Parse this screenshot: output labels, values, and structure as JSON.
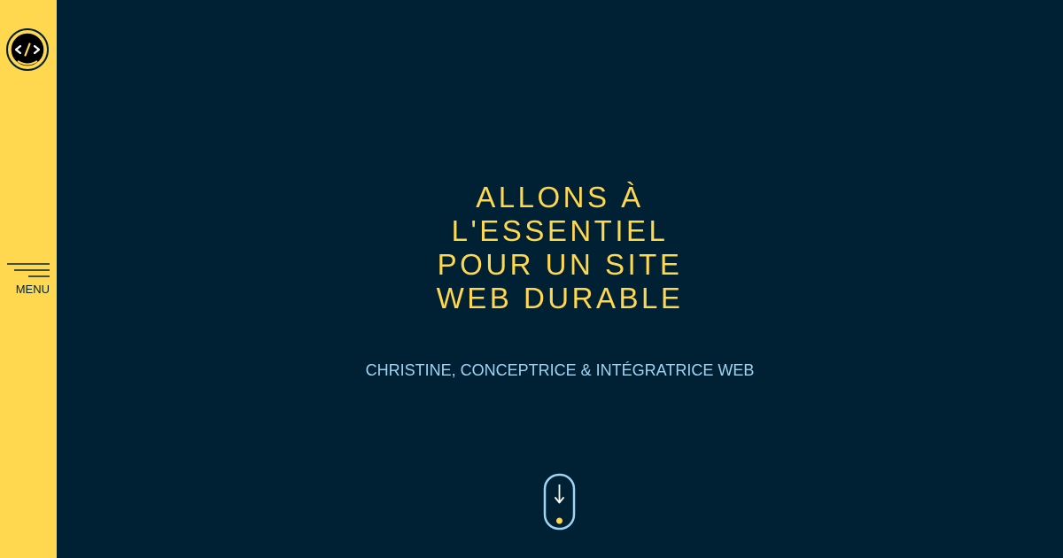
{
  "sidebar": {
    "logo_icon": "code-brackets-logo-icon",
    "menu_icon": "hamburger-menu-icon",
    "menu_label": "MENU"
  },
  "hero": {
    "title_lines": [
      "ALLONS À",
      "L'ESSENTIEL",
      "POUR UN SITE",
      "WEB DURABLE"
    ],
    "subtitle": "CHRISTINE, CONCEPTRICE & INTÉGRATRICE WEB"
  },
  "scroll": {
    "icon": "scroll-down-mouse-icon"
  },
  "colors": {
    "background": "#002133",
    "accent_yellow": "#ffd84f",
    "subtitle_blue": "#9fd4f4",
    "white": "#ffffff"
  }
}
